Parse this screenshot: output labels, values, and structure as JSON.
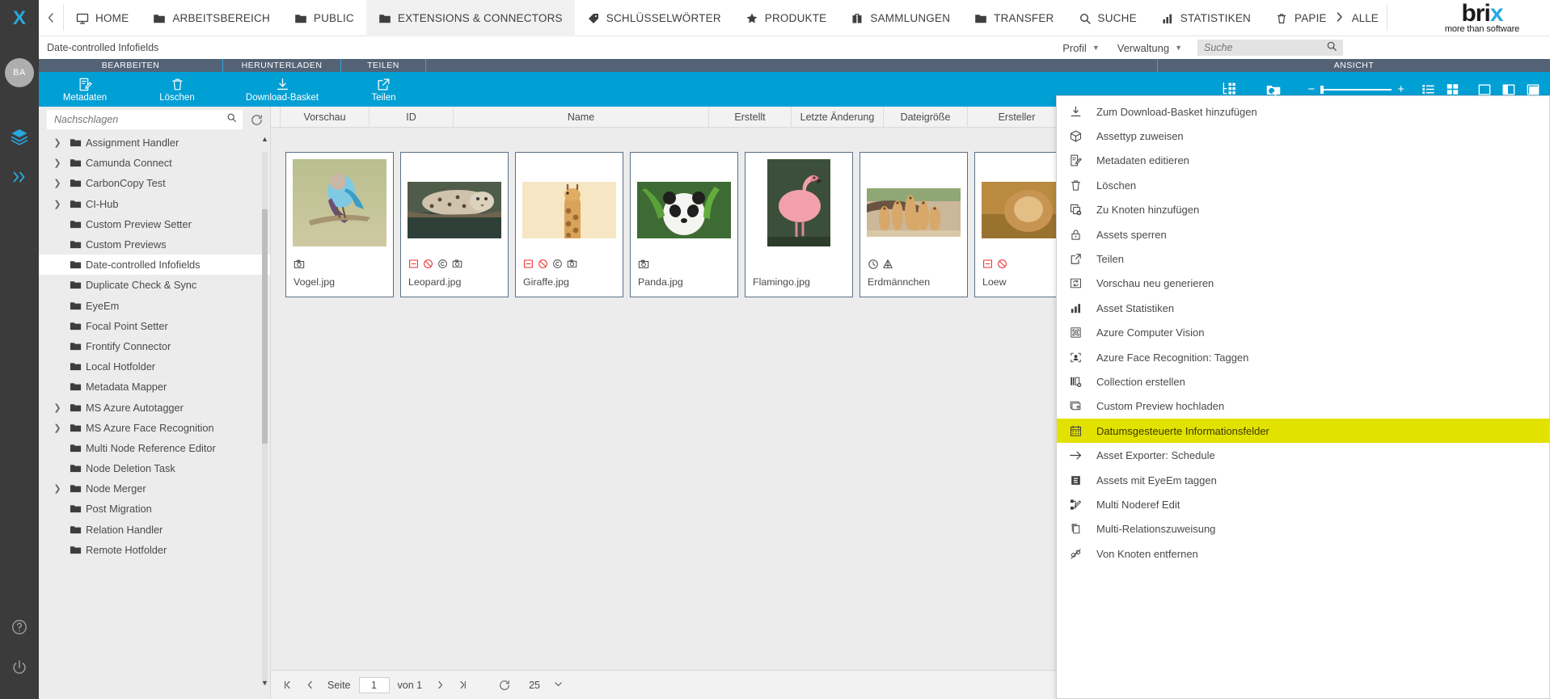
{
  "topnav": {
    "logo": "X",
    "collapse_icon": "chevron-left-icon",
    "items": [
      {
        "label": "HOME",
        "icon": "monitor-icon",
        "active": false
      },
      {
        "label": "ARBEITSBEREICH",
        "icon": "folder-icon",
        "active": false
      },
      {
        "label": "PUBLIC",
        "icon": "folder-icon",
        "active": false
      },
      {
        "label": "EXTENSIONS & CONNECTORS",
        "icon": "folder-icon",
        "active": true
      },
      {
        "label": "SCHLÜSSELWÖRTER",
        "icon": "tag-icon",
        "active": false
      },
      {
        "label": "PRODUKTE",
        "icon": "star-icon",
        "active": false
      },
      {
        "label": "SAMMLUNGEN",
        "icon": "briefcase-icon",
        "active": false
      },
      {
        "label": "TRANSFER",
        "icon": "folder-icon",
        "active": false
      },
      {
        "label": "SUCHE",
        "icon": "search-icon",
        "active": false
      },
      {
        "label": "STATISTIKEN",
        "icon": "bar-chart-icon",
        "active": false
      },
      {
        "label": "PAPIE",
        "icon": "trash-icon",
        "active": false
      }
    ],
    "more_label": "ALLE",
    "more_icon": "chevron-right-icon",
    "brand_name": "bri",
    "brand_accent": "x",
    "brand_tagline": "more than software",
    "accent_color": "#29a8df"
  },
  "subnav": {
    "breadcrumb": "Date-controlled Infofields",
    "profile_label": "Profil",
    "admin_label": "Verwaltung",
    "search_placeholder": "Suche",
    "search_value": "",
    "search_icon": "search-icon"
  },
  "ribbon": {
    "groups": [
      {
        "label": "BEARBEITEN"
      },
      {
        "label": "HERUNTERLADEN"
      },
      {
        "label": "TEILEN"
      },
      {
        "label": ""
      },
      {
        "label": "ANSICHT"
      }
    ],
    "buttons": [
      {
        "label": "Metadaten",
        "icon": "edit-metadata-icon"
      },
      {
        "label": "Löschen",
        "icon": "trash-icon"
      },
      {
        "label": "Download-Basket",
        "icon": "download-icon"
      },
      {
        "label": "Teilen",
        "icon": "share-icon"
      }
    ],
    "right_icons": [
      {
        "name": "tree-grid-icon"
      },
      {
        "name": "folder-search-icon"
      }
    ],
    "zoom": {
      "minus": "−",
      "plus": "+",
      "value": 5
    },
    "view_icons": [
      {
        "name": "list-view-icon"
      },
      {
        "name": "grid-view-icon"
      },
      {
        "name": "panel-none-icon"
      },
      {
        "name": "panel-left-icon"
      },
      {
        "name": "panel-right-icon"
      }
    ]
  },
  "tree": {
    "search_placeholder": "Nachschlagen",
    "search_value": "",
    "search_icon": "search-icon",
    "refresh_icon": "refresh-icon",
    "scroll_up_icon": "caret-up-icon",
    "scroll_down_icon": "caret-down-icon",
    "items": [
      {
        "label": "Assignment Handler",
        "expandable": true,
        "selected": false
      },
      {
        "label": "Camunda Connect",
        "expandable": true,
        "selected": false
      },
      {
        "label": "CarbonCopy Test",
        "expandable": true,
        "selected": false
      },
      {
        "label": "CI-Hub",
        "expandable": true,
        "selected": false
      },
      {
        "label": "Custom Preview Setter",
        "expandable": false,
        "selected": false
      },
      {
        "label": "Custom Previews",
        "expandable": false,
        "selected": false
      },
      {
        "label": "Date-controlled Infofields",
        "expandable": false,
        "selected": true
      },
      {
        "label": "Duplicate Check & Sync",
        "expandable": false,
        "selected": false
      },
      {
        "label": "EyeEm",
        "expandable": false,
        "selected": false
      },
      {
        "label": "Focal Point Setter",
        "expandable": false,
        "selected": false
      },
      {
        "label": "Frontify Connector",
        "expandable": false,
        "selected": false
      },
      {
        "label": "Local Hotfolder",
        "expandable": false,
        "selected": false
      },
      {
        "label": "Metadata Mapper",
        "expandable": false,
        "selected": false
      },
      {
        "label": "MS Azure Autotagger",
        "expandable": true,
        "selected": false
      },
      {
        "label": "MS Azure Face Recognition",
        "expandable": true,
        "selected": false
      },
      {
        "label": "Multi Node Reference Editor",
        "expandable": false,
        "selected": false
      },
      {
        "label": "Node Deletion Task",
        "expandable": false,
        "selected": false
      },
      {
        "label": "Node Merger",
        "expandable": true,
        "selected": false
      },
      {
        "label": "Post Migration",
        "expandable": false,
        "selected": false
      },
      {
        "label": "Relation Handler",
        "expandable": false,
        "selected": false
      },
      {
        "label": "Remote Hotfolder",
        "expandable": false,
        "selected": false
      }
    ]
  },
  "table": {
    "columns": [
      "Vorschau",
      "ID",
      "Name",
      "Erstellt",
      "Letzte Änderung",
      "Dateigröße",
      "Ersteller"
    ]
  },
  "assets": [
    {
      "name": "Vogel.jpg",
      "thumb": "bird-thumbnail",
      "badges": [
        {
          "icon": "asset-type-icon",
          "color": "#4a4a4a"
        }
      ]
    },
    {
      "name": "Leopard.jpg",
      "thumb": "leopard-thumbnail",
      "badges": [
        {
          "icon": "minus-box-icon",
          "color": "#e8312f"
        },
        {
          "icon": "no-entry-icon",
          "color": "#e8312f"
        },
        {
          "icon": "copyright-icon",
          "color": "#4a4a4a"
        },
        {
          "icon": "asset-type-icon",
          "color": "#4a4a4a"
        }
      ]
    },
    {
      "name": "Giraffe.jpg",
      "thumb": "giraffe-thumbnail",
      "badges": [
        {
          "icon": "minus-box-icon",
          "color": "#e8312f"
        },
        {
          "icon": "no-entry-icon",
          "color": "#e8312f"
        },
        {
          "icon": "copyright-icon",
          "color": "#4a4a4a"
        },
        {
          "icon": "asset-type-icon",
          "color": "#4a4a4a"
        }
      ]
    },
    {
      "name": "Panda.jpg",
      "thumb": "panda-thumbnail",
      "badges": [
        {
          "icon": "asset-type-icon",
          "color": "#4a4a4a"
        }
      ]
    },
    {
      "name": "Flamingo.jpg",
      "thumb": "flamingo-thumbnail",
      "badges": []
    },
    {
      "name": "Erdmännchen",
      "thumb": "meerkat-thumbnail",
      "badges": [
        {
          "icon": "clock-icon",
          "color": "#4a4a4a"
        },
        {
          "icon": "pyramid-icon",
          "color": "#4a4a4a"
        }
      ]
    },
    {
      "name": "Loew",
      "thumb": "lion-thumbnail",
      "badges": [
        {
          "icon": "minus-box-icon",
          "color": "#e8312f"
        },
        {
          "icon": "no-entry-icon",
          "color": "#e8312f"
        }
      ]
    }
  ],
  "pager": {
    "first_icon": "page-first-icon",
    "prev_icon": "page-prev-icon",
    "page_label": "Seite",
    "page_value": "1",
    "of_label": "von 1",
    "next_icon": "page-next-icon",
    "last_icon": "page-last-icon",
    "refresh_icon": "refresh-icon",
    "page_size": "25",
    "page_size_caret": "chevron-down-icon"
  },
  "context_menu": {
    "items": [
      {
        "label": "Zum Download-Basket hinzufügen",
        "icon": "download-icon",
        "highlighted": false
      },
      {
        "label": "Assettyp zuweisen",
        "icon": "cube-icon",
        "highlighted": false
      },
      {
        "label": "Metadaten editieren",
        "icon": "edit-metadata-icon",
        "highlighted": false
      },
      {
        "label": "Löschen",
        "icon": "trash-icon",
        "highlighted": false
      },
      {
        "label": "Zu Knoten hinzufügen",
        "icon": "add-to-node-icon",
        "highlighted": false
      },
      {
        "label": "Assets sperren",
        "icon": "lock-icon",
        "highlighted": false
      },
      {
        "label": "Teilen",
        "icon": "share-icon",
        "highlighted": false
      },
      {
        "label": "Vorschau neu generieren",
        "icon": "regenerate-preview-icon",
        "highlighted": false
      },
      {
        "label": "Asset Statistiken",
        "icon": "bar-chart-icon",
        "highlighted": false
      },
      {
        "label": "Azure Computer Vision",
        "icon": "computer-vision-icon",
        "highlighted": false
      },
      {
        "label": "Azure Face Recognition: Taggen",
        "icon": "face-recognition-icon",
        "highlighted": false
      },
      {
        "label": "Collection erstellen",
        "icon": "collection-add-icon",
        "highlighted": false
      },
      {
        "label": "Custom Preview hochladen",
        "icon": "upload-preview-icon",
        "highlighted": false
      },
      {
        "label": "Datumsgesteuerte Informationsfelder",
        "icon": "calendar-icon",
        "highlighted": true
      },
      {
        "label": "Asset Exporter: Schedule",
        "icon": "arrow-right-icon",
        "highlighted": false
      },
      {
        "label": "Assets mit EyeEm taggen",
        "icon": "eyeem-icon",
        "highlighted": false
      },
      {
        "label": "Multi Noderef Edit",
        "icon": "multi-noderef-icon",
        "highlighted": false
      },
      {
        "label": "Multi-Relationszuweisung",
        "icon": "multi-relation-icon",
        "highlighted": false
      },
      {
        "label": "Von Knoten entfernen",
        "icon": "remove-from-node-icon",
        "highlighted": false
      }
    ],
    "highlight_color": "#e2e200"
  },
  "rail": {
    "avatar_initials": "BA",
    "icons": [
      {
        "name": "layers-icon"
      },
      {
        "name": "expand-right-icon"
      },
      {
        "name": "help-icon"
      },
      {
        "name": "power-icon"
      }
    ]
  }
}
